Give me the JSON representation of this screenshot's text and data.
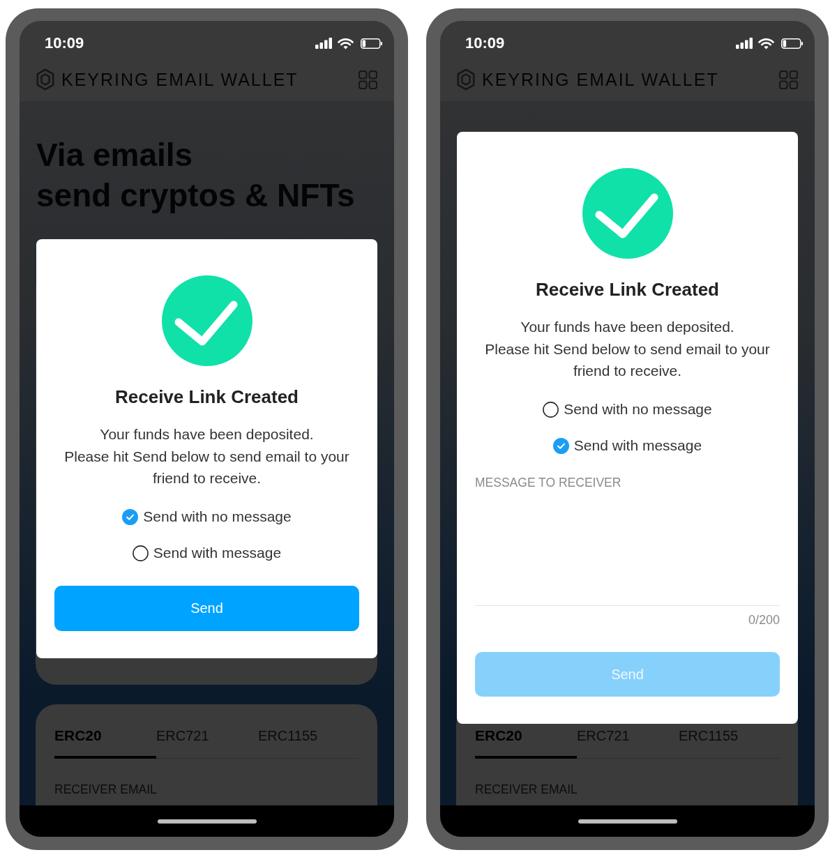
{
  "screens": [
    {
      "status_bar": {
        "time": "10:09"
      },
      "header": {
        "title": "KEYRING EMAIL WALLET"
      },
      "hero": {
        "lines": [
          "Via emails",
          "send cryptos & NFTs"
        ]
      },
      "upper_card": true,
      "tabs": [
        {
          "label": "ERC20",
          "selected": true
        },
        {
          "label": "ERC721",
          "selected": false
        },
        {
          "label": "ERC1155",
          "selected": false
        }
      ],
      "receiver_email_label": "RECEIVER EMAIL",
      "dialog": {
        "title": "Receive Link Created",
        "body": [
          "Your funds have been deposited.",
          "Please hit Send below to send email to your friend to receive."
        ],
        "options": [
          {
            "label": "Send with no message",
            "selected": true
          },
          {
            "label": "Send with message",
            "selected": false
          }
        ],
        "send_button": {
          "label": "Send",
          "disabled": false
        }
      }
    },
    {
      "status_bar": {
        "time": "10:09"
      },
      "header": {
        "title": "KEYRING EMAIL WALLET"
      },
      "tabs": [
        {
          "label": "ERC20",
          "selected": true
        },
        {
          "label": "ERC721",
          "selected": false
        },
        {
          "label": "ERC1155",
          "selected": false
        }
      ],
      "receiver_email_label": "RECEIVER EMAIL",
      "dialog": {
        "title": "Receive Link Created",
        "body": [
          "Your funds have been deposited.",
          "Please hit Send below to send email to your friend to receive."
        ],
        "options": [
          {
            "label": "Send with no message",
            "selected": false
          },
          {
            "label": "Send with message",
            "selected": true
          }
        ],
        "message_field": {
          "placeholder": "MESSAGE TO RECEIVER",
          "counter": "0/200"
        },
        "send_button": {
          "label": "Send",
          "disabled": true
        }
      }
    }
  ]
}
